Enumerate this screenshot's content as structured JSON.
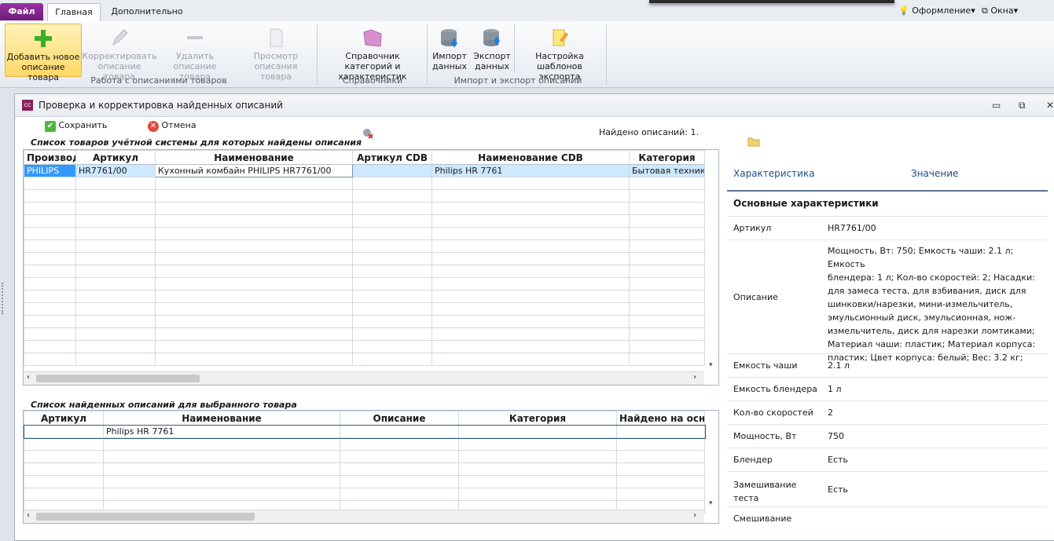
{
  "ribbon_tabs": {
    "file": "Файл",
    "home": "Главная",
    "extra": "Дополнительно"
  },
  "topright": {
    "design": "Оформление",
    "windows": "Окна"
  },
  "ribbon": {
    "add": "Добавить новое описание товара",
    "edit": "Корректировать описание товара",
    "delete": "Удалить описание товара",
    "view": "Просмотр описания товара",
    "group1": "Работа с описаниями товаров",
    "directory": "Справочник категорий и характеристик",
    "group2": "Справочники",
    "import": "Импорт данных",
    "export": "Экспорт данных",
    "templates": "Настройка шаблонов экспорта",
    "group3": "Импорт и экспорт описаний"
  },
  "window": {
    "title": "Проверка и корректировка найденных описаний",
    "icon_text": "cc"
  },
  "toolbar": {
    "save": "Сохранить",
    "cancel": "Отмена",
    "found": "Найдено описаний: 1."
  },
  "grid1": {
    "caption": "Список товаров учётной системы для которых найдены описания",
    "columns": [
      "Производи",
      "Артикул",
      "Наименование",
      "Артикул CDB",
      "Наименование CDB",
      "Категория"
    ],
    "rows": [
      [
        "PHILIPS",
        "HR7761/00",
        "Кухонный комбайн PHILIPS HR7761/00",
        "",
        "Philips HR 7761",
        "Бытовая техника"
      ]
    ]
  },
  "grid2": {
    "caption": "Список найденных описаний для выбранного товара",
    "columns": [
      "Артикул",
      "Наименование",
      "Описание",
      "Категория",
      "Найдено на осно"
    ],
    "rows": [
      [
        "",
        "Philips HR 7761",
        "",
        "",
        ""
      ]
    ]
  },
  "props": {
    "col_key": "Характеристика",
    "col_val": "Значение",
    "section": "Основные характеристики",
    "article_k": "Артикул",
    "article_v": "HR7761/00",
    "desc_k": "Описание",
    "desc_lines": [
      "Мощность, Вт: 750; Емкость чаши: 2.1 л; Емкость",
      "блендера: 1 л; Кол-во скоростей: 2; Насадки:",
      "для замеса теста, для взбивания, диск для",
      "шинковки/нарезки, мини-измельчитель,",
      "эмульсионный диск, эмульсионная, нож-",
      "измельчитель, диск для нарезки ломтиками;",
      "Материал чаши: пластик; Материал корпуса:",
      "пластик; Цвет корпуса: белый; Вес: 3.2 кг;"
    ],
    "bowl_k": "Емкость чаши",
    "bowl_v": "2.1 л",
    "blender_cap_k": "Емкость блендера",
    "blender_cap_v": "1 л",
    "speeds_k": "Кол-во скоростей",
    "speeds_v": "2",
    "power_k": "Мощность, Вт",
    "power_v": "750",
    "blender_k": "Блендер",
    "blender_v": "Есть",
    "knead_k1": "Замешивание",
    "knead_k2": "теста",
    "knead_v": "Есть",
    "mix_k": "Смешивание"
  },
  "colors": {
    "accent": "#ffd767",
    "file_tab": "#7b2183",
    "selection": "#cde8ff",
    "row_selected_cell": "#3399ff"
  }
}
